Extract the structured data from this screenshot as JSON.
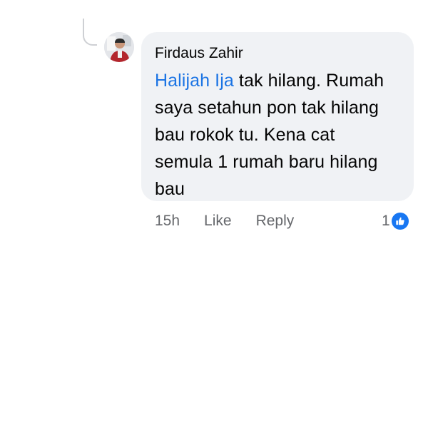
{
  "comment": {
    "author": "Firdaus Zahir",
    "mention": "Halijah Ija",
    "lines": [
      " tak hilang. Rumah",
      "saya setahun pon tak hilang",
      "bau rokok tu. Kena cat",
      "semula 1 rumah baru hilang",
      "bau"
    ]
  },
  "actions": {
    "timestamp": "15h",
    "like_label": "Like",
    "reply_label": "Reply"
  },
  "reactions": {
    "count": "1",
    "icon": "thumbs-up-icon",
    "badge_color": "#1877f2"
  },
  "colors": {
    "bubble": "#f0f2f5",
    "mention": "#1b74e4",
    "meta_text": "#65676b"
  }
}
